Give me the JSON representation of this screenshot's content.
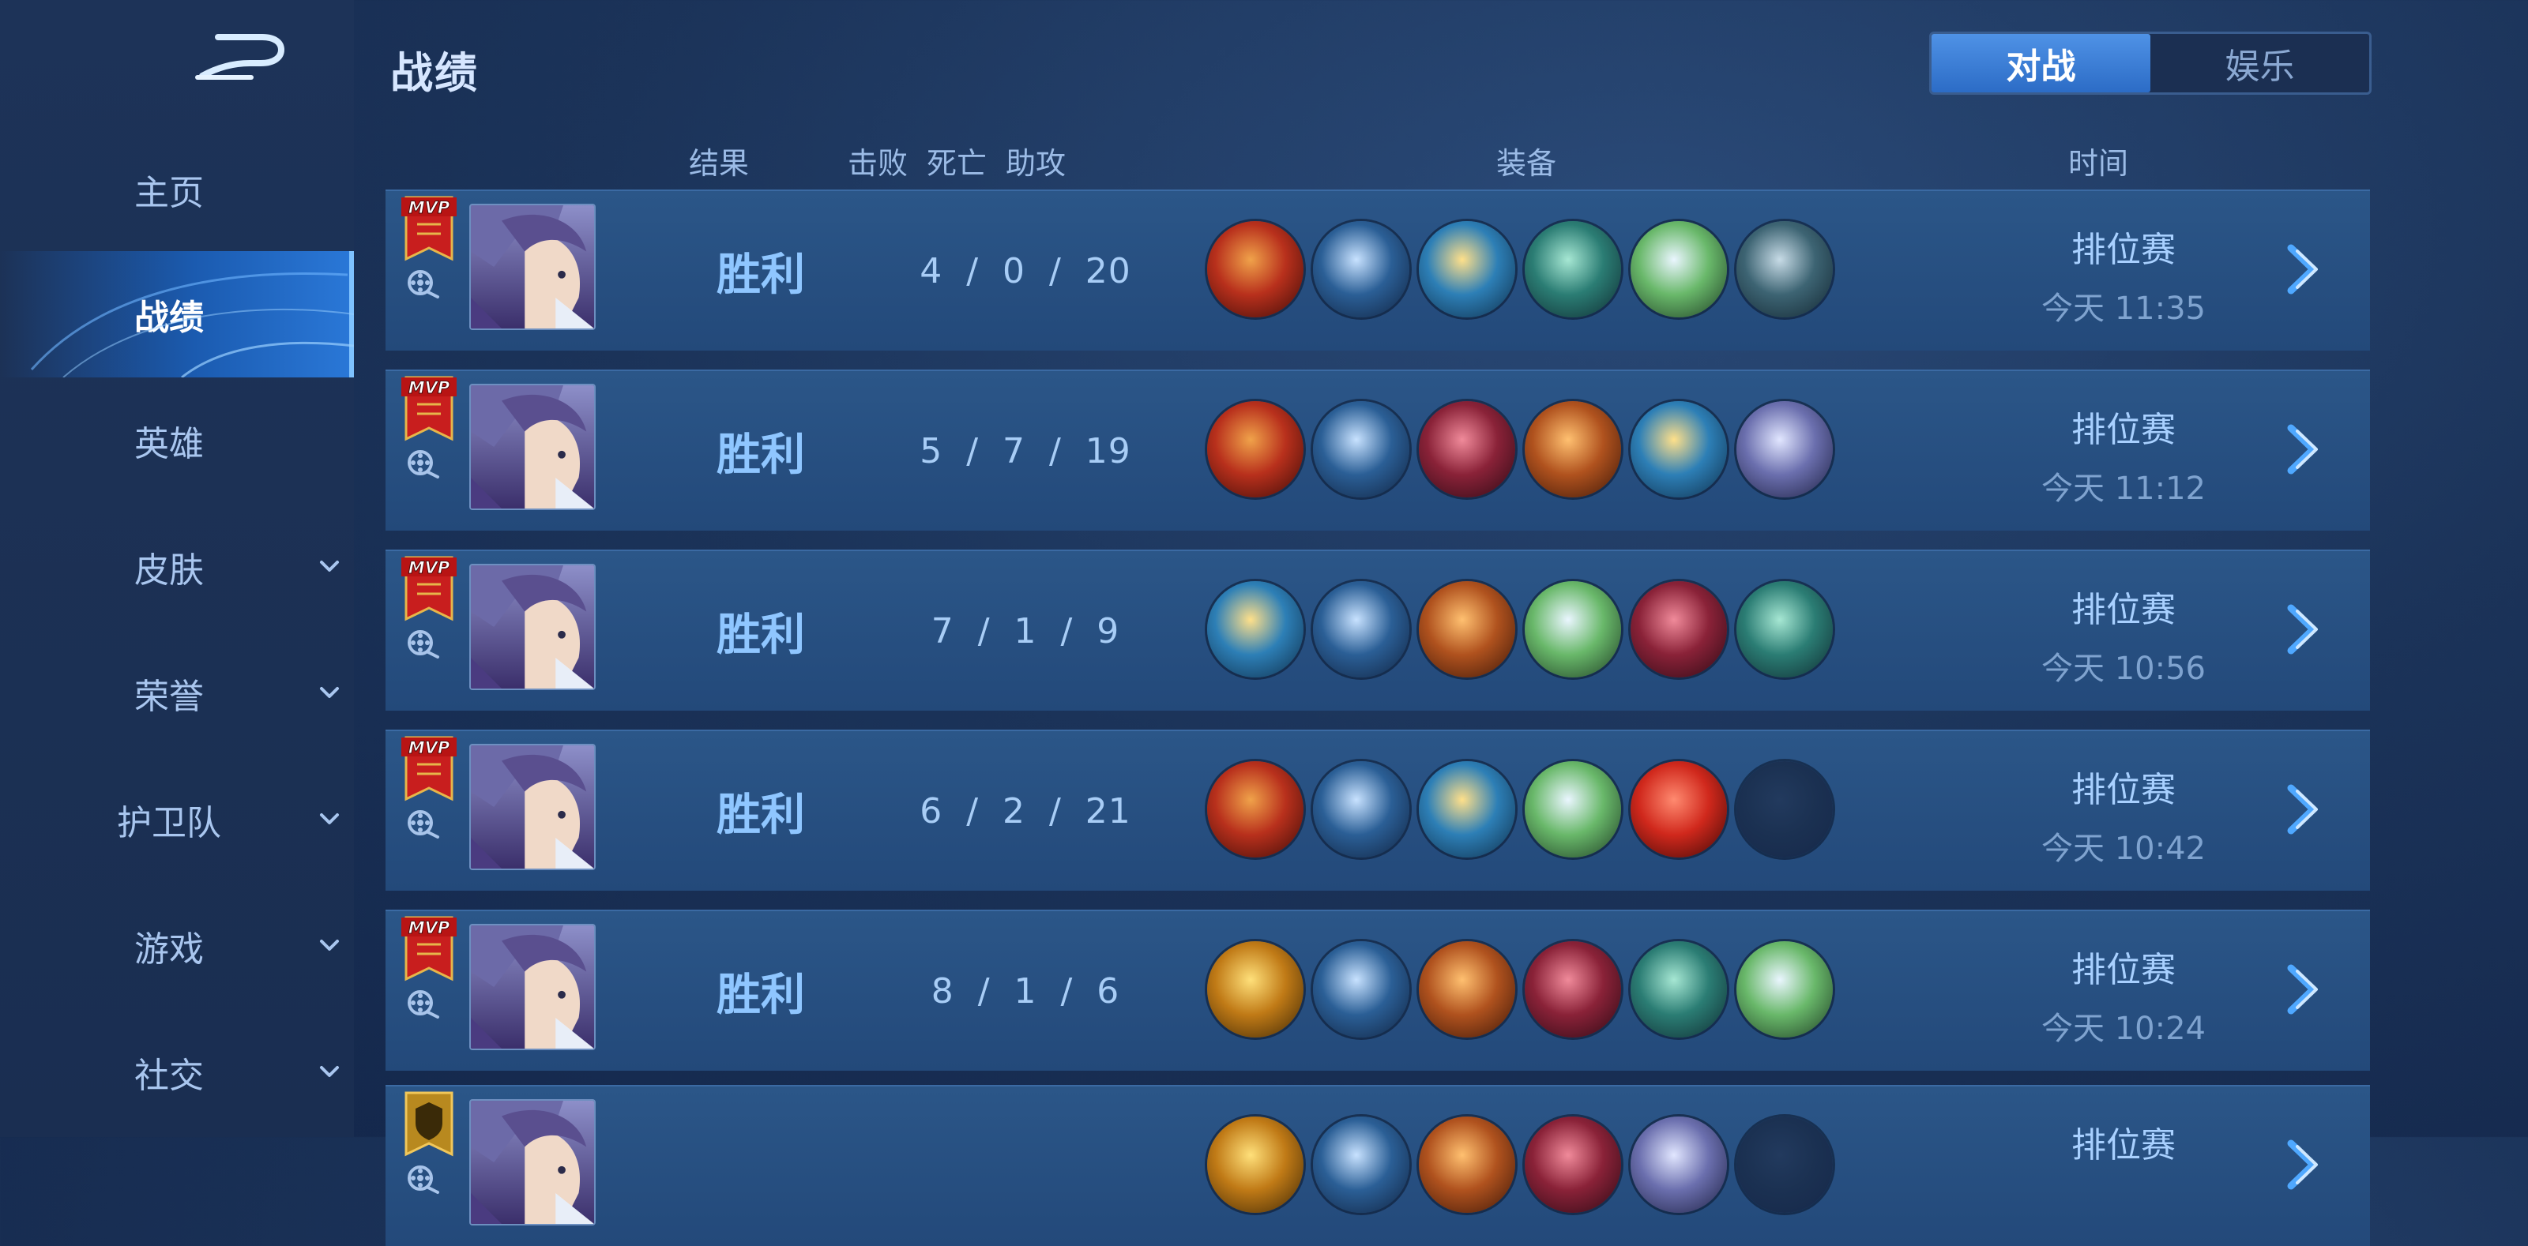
{
  "sidebar": {
    "items": [
      {
        "label": "主页",
        "name": "sidebar-item-home",
        "active": false,
        "chevron": false
      },
      {
        "label": "战绩",
        "name": "sidebar-item-record",
        "active": true,
        "chevron": false
      },
      {
        "label": "英雄",
        "name": "sidebar-item-heroes",
        "active": false,
        "chevron": false
      },
      {
        "label": "皮肤",
        "name": "sidebar-item-skins",
        "active": false,
        "chevron": true
      },
      {
        "label": "荣誉",
        "name": "sidebar-item-honor",
        "active": false,
        "chevron": true
      },
      {
        "label": "护卫队",
        "name": "sidebar-item-guard",
        "active": false,
        "chevron": true
      },
      {
        "label": "游戏",
        "name": "sidebar-item-games",
        "active": false,
        "chevron": true
      },
      {
        "label": "社交",
        "name": "sidebar-item-social",
        "active": false,
        "chevron": true
      }
    ]
  },
  "header": {
    "title": "战绩",
    "tabs": [
      {
        "label": "对战",
        "active": true
      },
      {
        "label": "娱乐",
        "active": false
      }
    ]
  },
  "columns": {
    "result": "结果",
    "kills": "击败",
    "deaths": "死亡",
    "assists": "助攻",
    "equipment": "装备",
    "time": "时间"
  },
  "rows": [
    {
      "badge": "MVP",
      "result": "胜利",
      "kda": "4  /  0  /  20",
      "mode": "排位赛",
      "date": "今天 11:35",
      "items": [
        "fire-orb",
        "red-wings",
        "gold-shield",
        "green-boots",
        "silver-claw",
        "armor-belt"
      ]
    },
    {
      "badge": "MVP",
      "result": "胜利",
      "kda": "5  /  7  /  19",
      "mode": "排位赛",
      "date": "今天 11:12",
      "items": [
        "fire-orb",
        "red-wings",
        "crimson-armor",
        "bronze-helm",
        "gold-shield",
        "silver-mask"
      ]
    },
    {
      "badge": "MVP",
      "result": "胜利",
      "kda": "7  /  1  /  9",
      "mode": "排位赛",
      "date": "今天 10:56",
      "items": [
        "gold-shield",
        "red-wings",
        "bronze-helm",
        "silver-claw",
        "crimson-armor",
        "green-boots"
      ]
    },
    {
      "badge": "MVP",
      "result": "胜利",
      "kda": "6  /  2  /  21",
      "mode": "排位赛",
      "date": "今天 10:42",
      "items": [
        "fire-orb",
        "red-wings",
        "gold-shield",
        "silver-claw",
        "red-gem",
        "empty"
      ]
    },
    {
      "badge": "MVP",
      "result": "胜利",
      "kda": "8  /  1  /  6",
      "mode": "排位赛",
      "date": "今天 10:24",
      "items": [
        "golden-spear",
        "red-wings",
        "bronze-helm",
        "crimson-armor",
        "green-boots",
        "silver-claw"
      ]
    },
    {
      "badge": "shield",
      "result": "",
      "kda": "",
      "mode": "排位赛",
      "date": "",
      "items": [
        "golden-spear",
        "red-wings",
        "bronze-helm",
        "crimson-armor",
        "silver-mask",
        "empty"
      ]
    }
  ],
  "item_colors": {
    "fire-orb": [
      "#f0a24a",
      "#b8301c",
      "#3a0b08"
    ],
    "red-wings": [
      "#c8e2ff",
      "#2b5f96",
      "#10223f"
    ],
    "gold-shield": [
      "#ffe08a",
      "#2d7fb6",
      "#0f2d48"
    ],
    "green-boots": [
      "#a6e7d3",
      "#2b7d74",
      "#0f2a30"
    ],
    "silver-claw": [
      "#eaf6ff",
      "#69b86a",
      "#1d3a23"
    ],
    "armor-belt": [
      "#c7dbe6",
      "#3d6473",
      "#122530"
    ],
    "crimson-armor": [
      "#f08a9a",
      "#8a2238",
      "#2a0a14"
    ],
    "bronze-helm": [
      "#ffc070",
      "#b0521e",
      "#3a1608"
    ],
    "silver-mask": [
      "#e1e6ff",
      "#6b6fae",
      "#1c1f40"
    ],
    "red-gem": [
      "#ff8a70",
      "#d0281c",
      "#3a0806"
    ],
    "golden-spear": [
      "#ffe07a",
      "#c07a16",
      "#3a2506"
    ],
    "empty": [
      "#223a5e",
      "#1b3152",
      "#16284a"
    ]
  },
  "colors": {
    "accent": "#2c6cc6",
    "win": "#8fc6ff"
  }
}
